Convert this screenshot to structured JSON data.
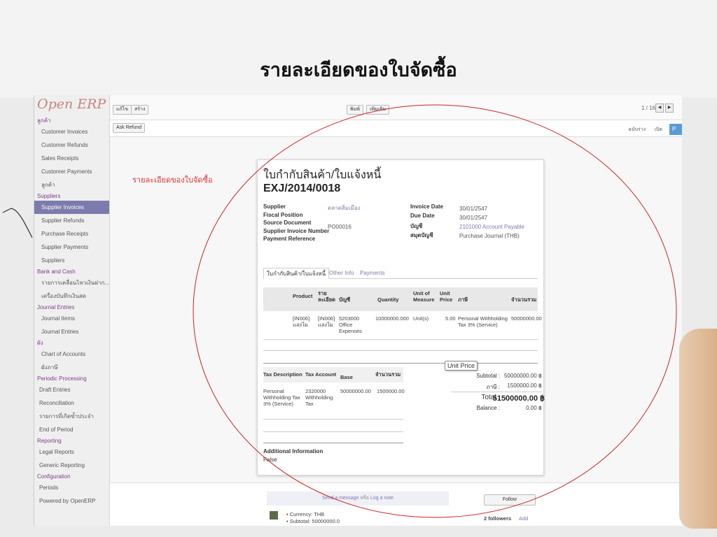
{
  "slide": {
    "title": "รายละเอียดของใบจัดซื้อ"
  },
  "sidebar": {
    "logo": "Open ERP",
    "sections": [
      {
        "label": "ลูกค้า",
        "items": [
          "Customer Invoices",
          "Customer Refunds",
          "Sales Receipts",
          "Customer Payments",
          "ลูกค้า"
        ]
      },
      {
        "label": "Suppliers",
        "items": [
          "Supplier Invoices",
          "Supplier Refunds",
          "Purchase Receipts",
          "Supplier Payments",
          "Suppliers"
        ]
      },
      {
        "label": "Bank and Cash",
        "items": [
          "รายการเคลื่อนไหวเงินฝาก...",
          "เครื่องบันทึกเงินสด"
        ]
      },
      {
        "label": "Journal Entries",
        "items": [
          "Journal Items",
          "Journal Entries"
        ]
      },
      {
        "label": "ผัง",
        "items": [
          "Chart of Accounts",
          "ผังภาษี"
        ]
      },
      {
        "label": "Periodic Processing",
        "items": [
          "Draft Entries",
          "Reconciliation",
          "รายการที่เกิดซ้ำประจำ",
          "End of Period"
        ]
      },
      {
        "label": "Reporting",
        "items": [
          "Legal Reports",
          "Generic Reporting"
        ]
      },
      {
        "label": "Configuration",
        "items": [
          "Periods",
          "Powered by OpenERP"
        ]
      }
    ],
    "selected": "Supplier Invoices"
  },
  "toolbar": {
    "edit": "แก้ไข",
    "create": "สร้าง",
    "print": "พิมพ์",
    "more": "เพิ่มเติม",
    "pager": "1 / 16",
    "ask_refund": "Ask Refund",
    "stage_draft": "ฉบับร่าง",
    "stage_open": "เปิด",
    "stage_paid": "P"
  },
  "annotation": "รายละเอียดของใบจัดซื้อ",
  "invoice": {
    "title": "ใบกำกับสินค้า/ใบแจ้งหนี้",
    "number": "EXJ/2014/0018",
    "left_fields": [
      {
        "label": "Supplier",
        "value": "ตลาดสิ่มเมือง"
      },
      {
        "label": "Fiscal Position",
        "value": ""
      },
      {
        "label": "Source Document",
        "value": "PO00016"
      },
      {
        "label": "Supplier Invoice Number",
        "value": ""
      },
      {
        "label": "Payment Reference",
        "value": ""
      }
    ],
    "right_fields": [
      {
        "label": "Invoice Date",
        "value": "30/01/2547"
      },
      {
        "label": "Due Date",
        "value": "30/01/2547"
      },
      {
        "label": "บัญชี",
        "value": "2101000 Account Payable"
      },
      {
        "label": "สมุดบัญชี",
        "value": "Purchase Journal (THB)"
      }
    ],
    "tabs": [
      "ใบกำกับสินค้า/ใบแจ้งหนี้",
      "Other Info",
      "Payments"
    ],
    "line_headers": [
      "Product",
      "รายละเอียด",
      "บัญชี",
      "Quantity",
      "Unit of Measure",
      "Unit Price",
      "ภาษี",
      "จำนวนรวม"
    ],
    "lines": [
      {
        "product": "[IN006] แลงไม",
        "desc": "[IN006] แลงไม",
        "account": "5203000 Office Expenses",
        "qty": "10000000.000",
        "uom": "Unit(s)",
        "price": "5.00",
        "tax": "Personal Withholding Tax 3% (Service)",
        "total": "50000000.00"
      }
    ],
    "tax_headers": [
      "Tax Description",
      "Tax Account",
      "Base",
      "จำนวนรวม"
    ],
    "tax_lines": [
      {
        "desc": "Personal Withholding Tax 3% (Service)",
        "account": "2320000 Withholding Tax",
        "base": "50000000.00",
        "amount": "1500000.00"
      }
    ],
    "subtotal_label": "Subtotal :",
    "subtotal": "50000000.00 ฿",
    "tax_label": "ภาษี :",
    "tax": "1500000.00 ฿",
    "total_label": "Total :",
    "total": "51500000.00 ฿",
    "balance_label": "Balance :",
    "balance": "0.00 ฿",
    "additional_label": "Additional Information",
    "additional_value": "False",
    "tooltip": "Unit Price"
  },
  "chatter": {
    "send": "Send a message",
    "or": "หรือ",
    "log": "Log a note",
    "follow": "Follow",
    "followers": "2 followers",
    "add": "Add",
    "currency": "• Currency: THB",
    "subtotal": "• Subtotal: 50000000.0"
  },
  "colors": {
    "accent": "#7c7bad",
    "annotation": "#dd3333",
    "ellipse": "#cc2222"
  }
}
